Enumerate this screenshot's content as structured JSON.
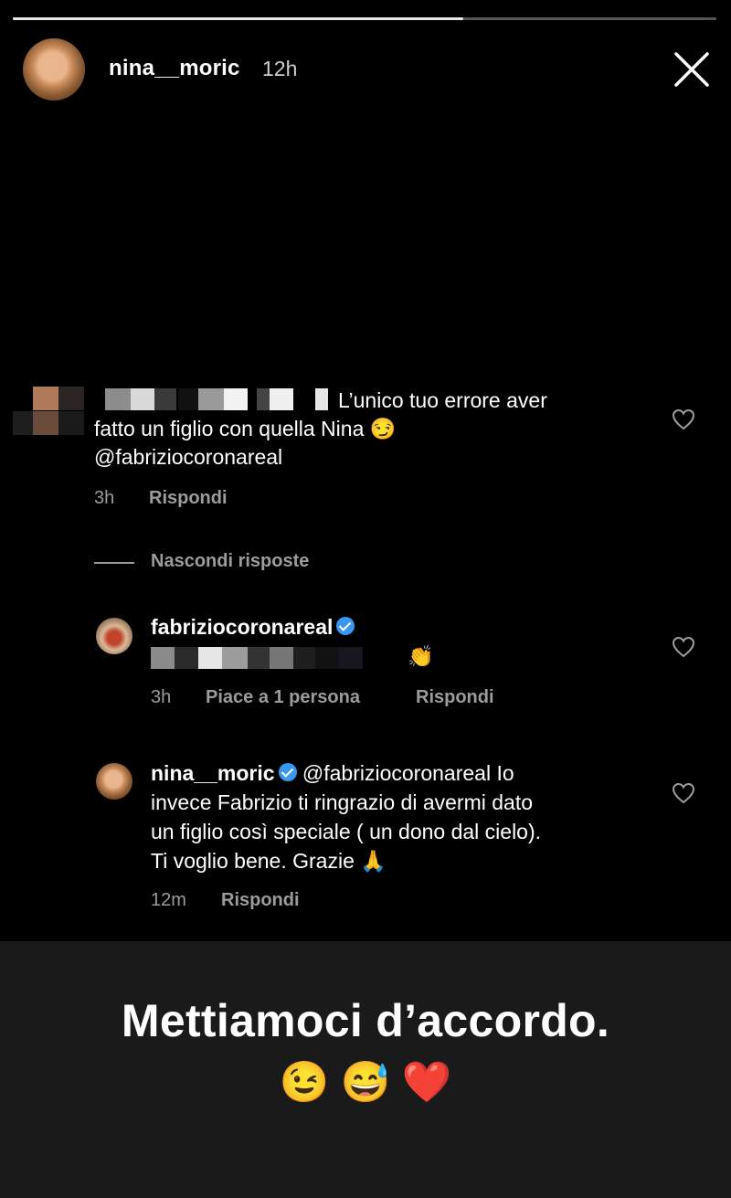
{
  "story": {
    "progress_fraction": 0.64,
    "username": "nina__moric",
    "time": "12h"
  },
  "comments": {
    "first": {
      "text_line1": "L’unico tuo errore aver",
      "text_line2": "fatto un figlio con quella Nina 😏",
      "text_line3": "@fabriziocoronareal",
      "time": "3h",
      "reply": "Rispondi"
    },
    "hide_replies": "Nascondi risposte",
    "reply1": {
      "username": "fabriziocoronareal",
      "emoji": "👏",
      "time": "3h",
      "likes": "Piace a 1 persona",
      "reply": "Rispondi"
    },
    "reply2": {
      "username": "nina__moric",
      "mention": "@fabriziocoronareal",
      "line1_tail": " Io",
      "line2": "invece Fabrizio ti ringrazio di avermi dato",
      "line3": "un figlio così speciale ( un dono dal cielo).",
      "line4": "Ti voglio bene. Grazie 🙏",
      "time": "12m",
      "reply": "Rispondi"
    }
  },
  "caption": {
    "text": "Mettiamoci d’accordo.",
    "emojis": "😉 😅 ❤️"
  }
}
